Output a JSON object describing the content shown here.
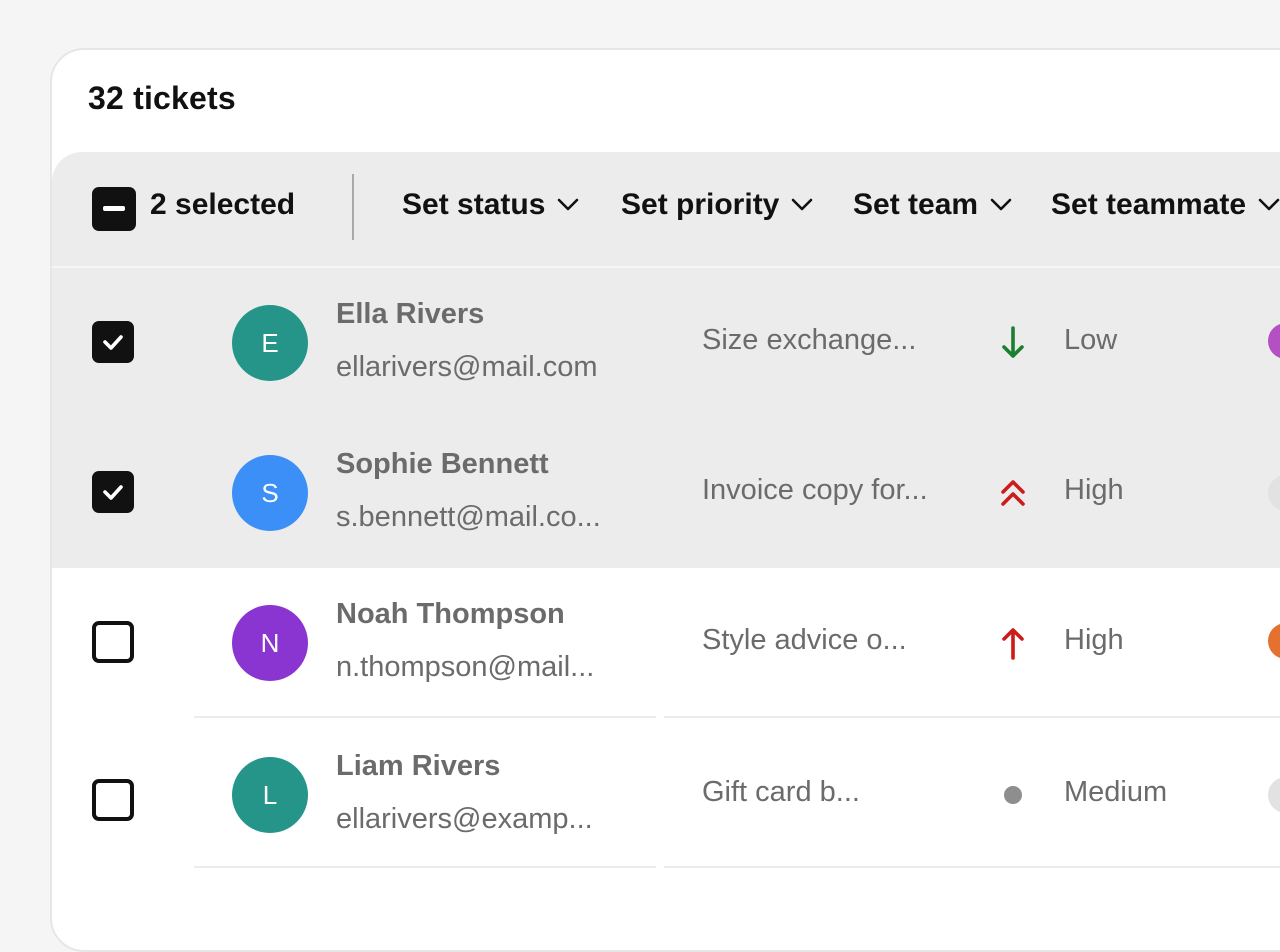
{
  "header": {
    "ticket_count": "32 tickets"
  },
  "toolbar": {
    "selected_label": "2 selected",
    "actions": [
      {
        "label": "Set status"
      },
      {
        "label": "Set priority"
      },
      {
        "label": "Set team"
      },
      {
        "label": "Set teammate"
      }
    ]
  },
  "tickets": [
    {
      "selected": true,
      "initial": "E",
      "name": "Ella Rivers",
      "email": "ellarivers@mail.com",
      "subject": "Size exchange...",
      "priority": "Low",
      "priority_icon": "arrow-down-icon",
      "avatar_color": "#25958a",
      "priority_color": "#1a7f2e"
    },
    {
      "selected": true,
      "initial": "S",
      "name": "Sophie Bennett",
      "email": "s.bennett@mail.co...",
      "subject": "Invoice copy for...",
      "priority": "High",
      "priority_icon": "double-chevron-up-icon",
      "avatar_color": "#3b8ff6",
      "priority_color": "#cc1b1b"
    },
    {
      "selected": false,
      "initial": "N",
      "name": "Noah Thompson",
      "email": "n.thompson@mail...",
      "subject": "Style advice o...",
      "priority": "High",
      "priority_icon": "arrow-up-icon",
      "avatar_color": "#8a35d1",
      "priority_color": "#cc1b1b"
    },
    {
      "selected": false,
      "initial": "L",
      "name": "Liam Rivers",
      "email": "ellarivers@examp...",
      "subject": "Gift card b...",
      "priority": "Medium",
      "priority_icon": "dot-icon",
      "avatar_color": "#25958a",
      "priority_color": "#8e8e8e"
    }
  ]
}
